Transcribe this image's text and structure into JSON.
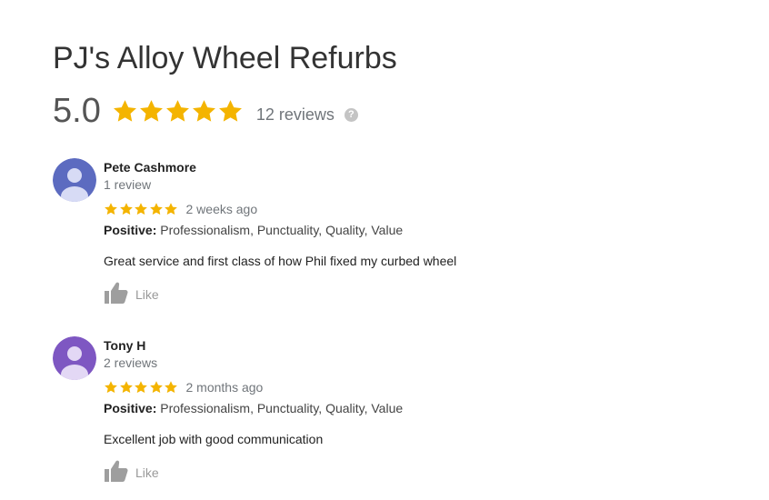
{
  "business": {
    "name": "PJ's Alloy Wheel Refurbs",
    "rating": "5.0",
    "stars": 5,
    "reviews_label": "12 reviews",
    "help_icon": "question-circle-icon",
    "help_glyph": "?"
  },
  "colors": {
    "star": "#f4b400",
    "star_empty": "#dadce0",
    "avatar_1": "#5c6bc0",
    "avatar_2": "#7e57c2",
    "like_icon": "#9e9e9e"
  },
  "reviews": [
    {
      "name": "Pete Cashmore",
      "reviewer_reviews": "1 review",
      "stars": 5,
      "date": "2 weeks ago",
      "positive_label": "Positive:",
      "positive_values": "Professionalism, Punctuality, Quality, Value",
      "text": "Great service and first class of how Phil fixed my curbed wheel",
      "like_label": "Like",
      "avatar_icon": "default-person-avatar-icon"
    },
    {
      "name": "Tony H",
      "reviewer_reviews": "2 reviews",
      "stars": 5,
      "date": "2 months ago",
      "positive_label": "Positive:",
      "positive_values": "Professionalism, Punctuality, Quality, Value",
      "text": "Excellent job with good communication",
      "like_label": "Like",
      "avatar_icon": "default-person-avatar-icon"
    }
  ]
}
